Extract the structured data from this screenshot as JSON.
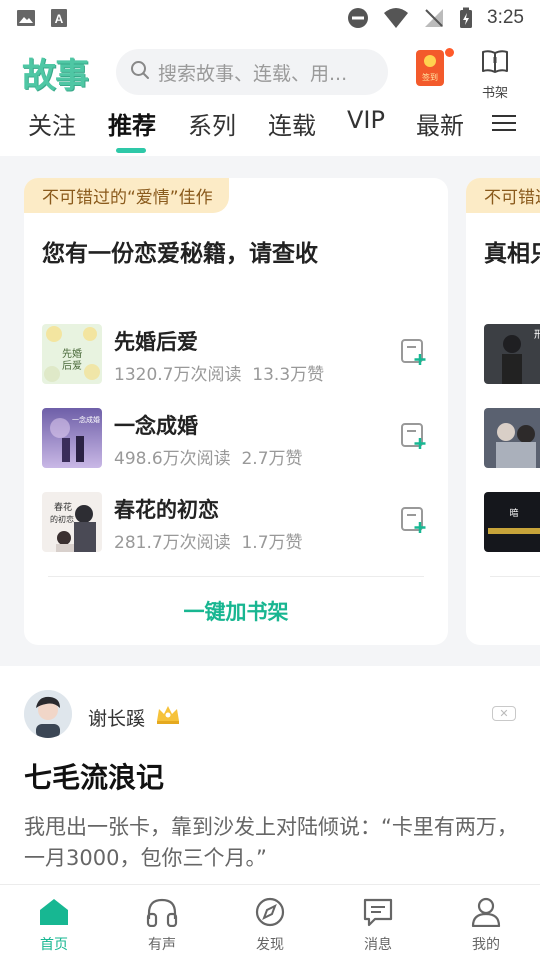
{
  "status_bar": {
    "time": "3:25"
  },
  "header": {
    "logo": "故事",
    "search_placeholder": "搜索故事、连载、用...",
    "redpacket_label": "签到",
    "shelf_label": "书架"
  },
  "tabs": [
    {
      "label": "关注"
    },
    {
      "label": "推荐",
      "active": true
    },
    {
      "label": "系列"
    },
    {
      "label": "连载"
    },
    {
      "label": "VIP"
    },
    {
      "label": "最新"
    }
  ],
  "cards": [
    {
      "tag": "不可错过的“爱情”佳作",
      "title": "您有一份恋爱秘籍，请查收",
      "books": [
        {
          "name": "先婚后爱",
          "reads": "1320.7万次阅读",
          "likes": "13.3万赞"
        },
        {
          "name": "一念成婚",
          "reads": "498.6万次阅读",
          "likes": "2.7万赞"
        },
        {
          "name": "春花的初恋",
          "reads": "281.7万次阅读",
          "likes": "1.7万赞"
        }
      ],
      "add_all": "一键加书架"
    },
    {
      "tag": "不可错过的",
      "title": "真相只"
    }
  ],
  "post": {
    "author": "谢长蹊",
    "title": "七毛流浪记",
    "excerpt": "我甩出一张卡，靠到沙发上对陆倾说：“卡里有两万，一月3000，包你三个月。”"
  },
  "bottom_nav": [
    {
      "label": "首页",
      "icon": "home-icon",
      "active": true
    },
    {
      "label": "有声",
      "icon": "headphones-icon"
    },
    {
      "label": "发现",
      "icon": "compass-icon"
    },
    {
      "label": "消息",
      "icon": "message-icon"
    },
    {
      "label": "我的",
      "icon": "profile-icon"
    }
  ],
  "colors": {
    "accent": "#17b792",
    "tag_bg": "#fcebc6",
    "tag_text": "#8a5a1c"
  }
}
